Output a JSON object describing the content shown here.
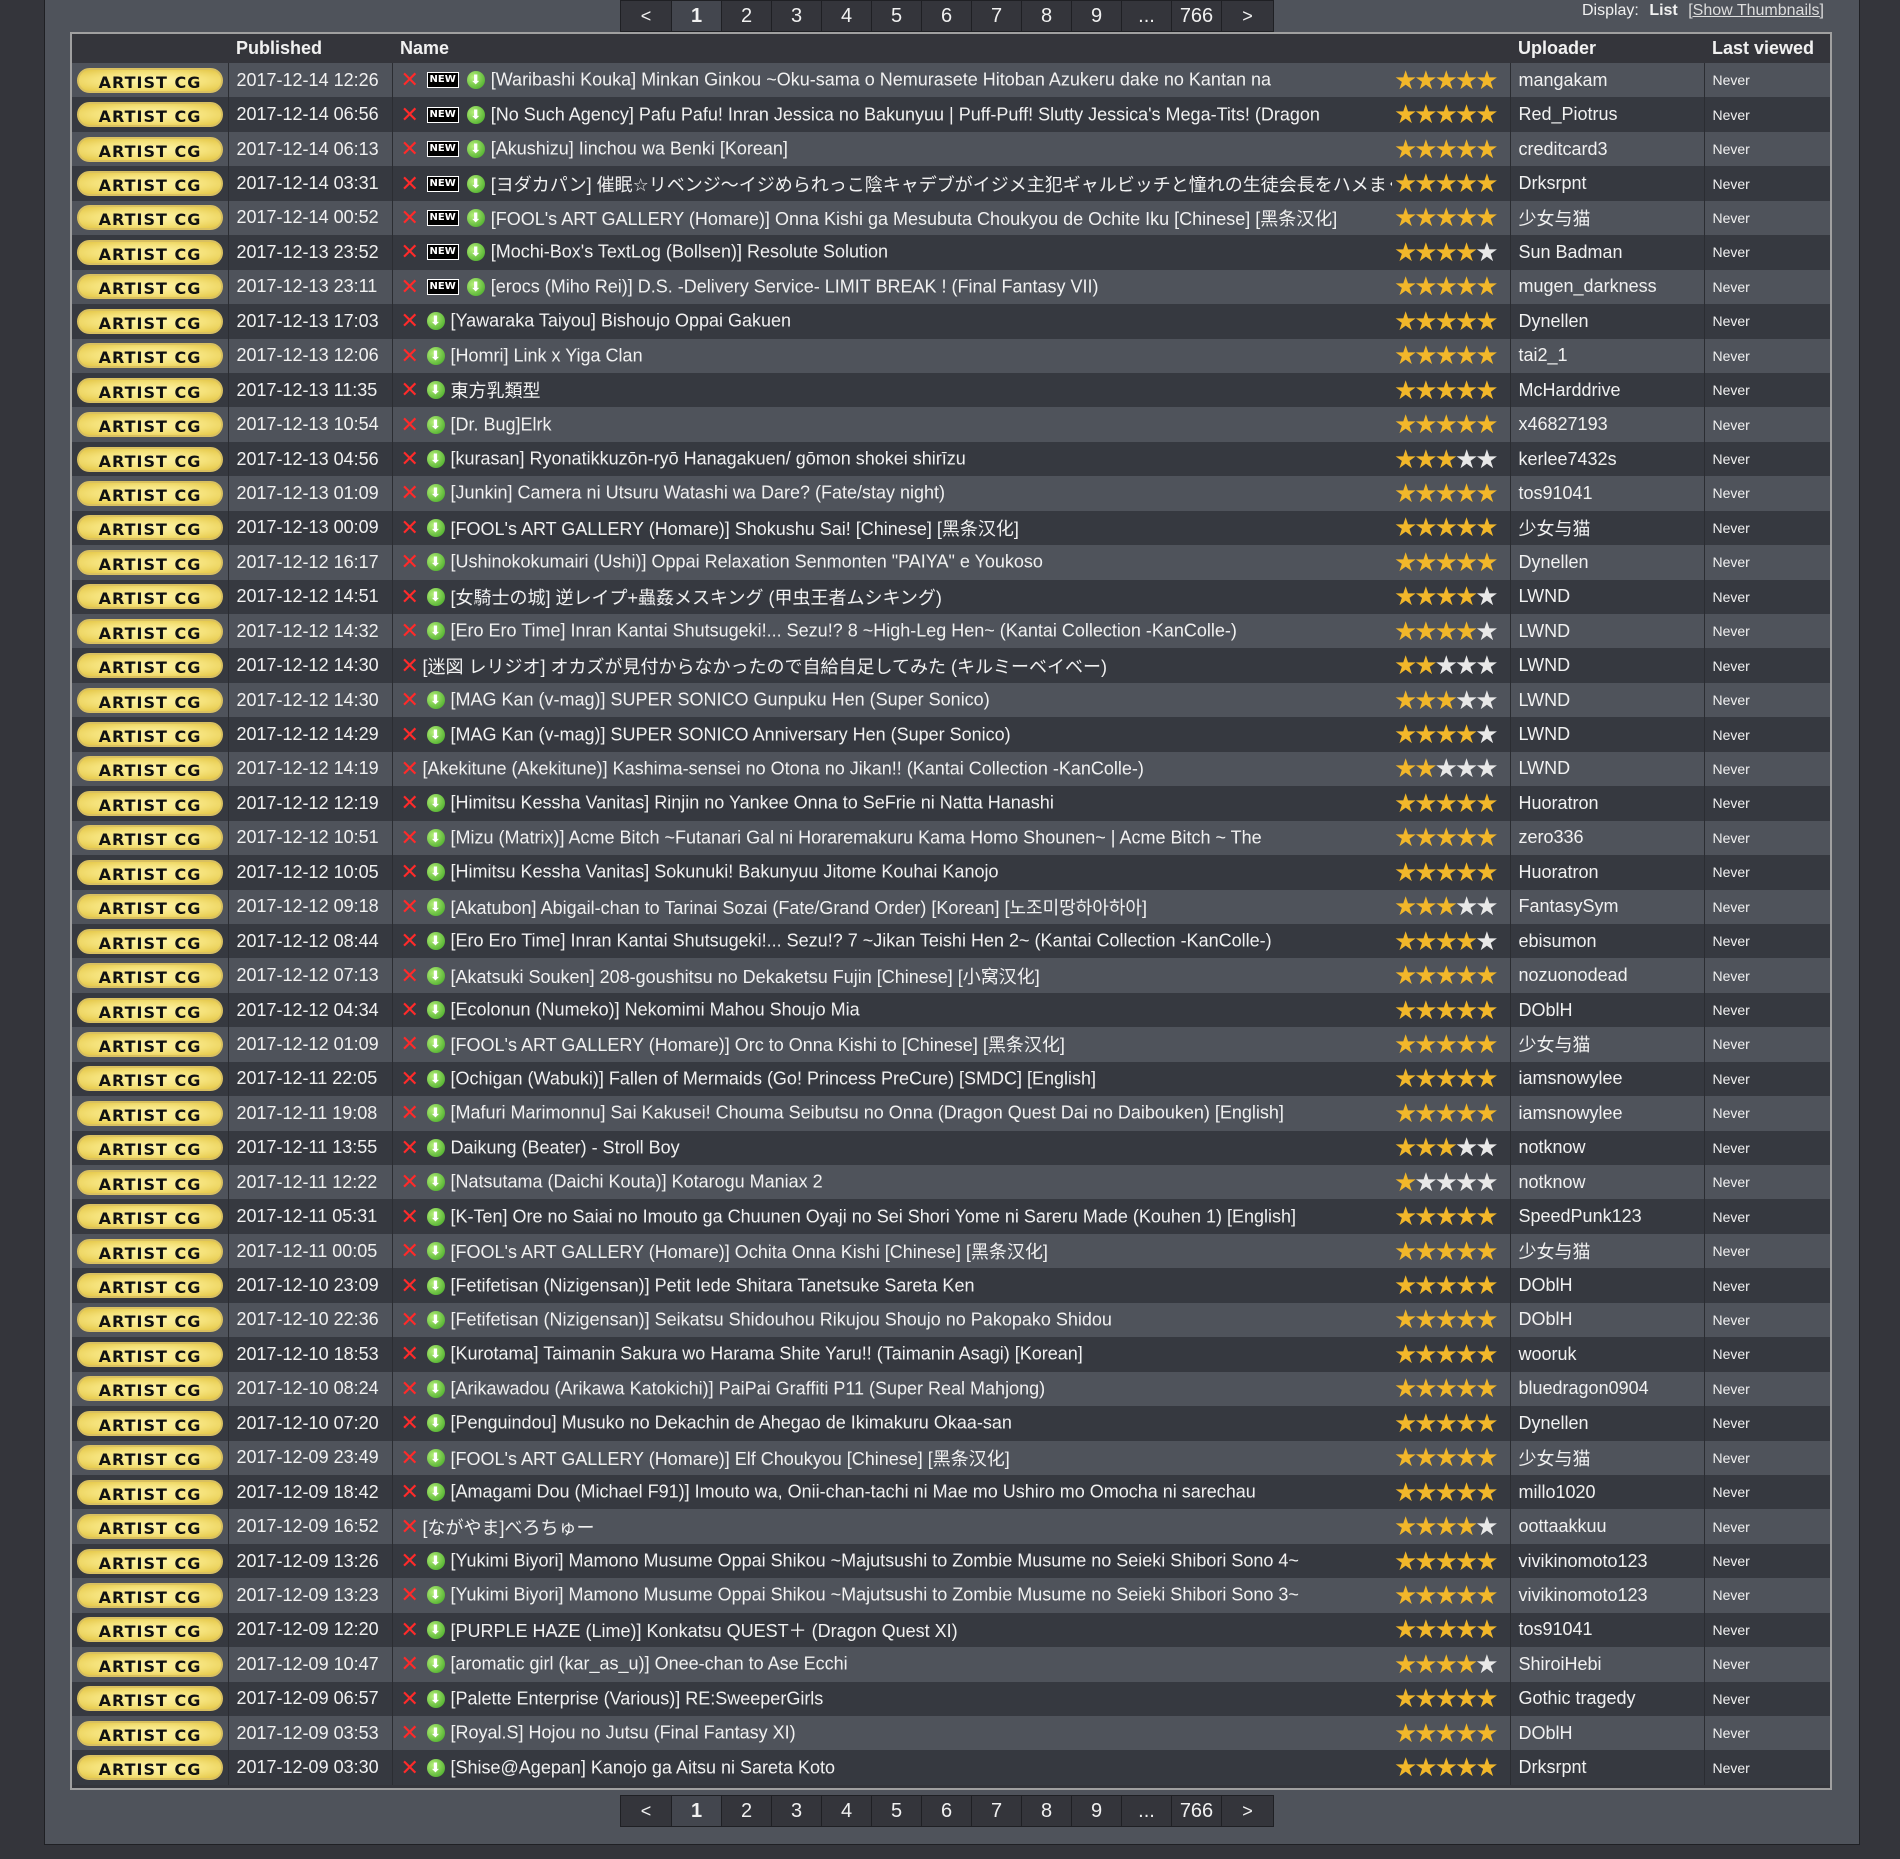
{
  "pager": {
    "pages": [
      "<",
      "1",
      "2",
      "3",
      "4",
      "5",
      "6",
      "7",
      "8",
      "9",
      "...",
      "766",
      ">"
    ],
    "current": "1"
  },
  "display": {
    "label": "Display:",
    "current": "List",
    "alternative": "[Show Thumbnails]"
  },
  "columns": [
    "Published",
    "Name",
    "Uploader",
    "Last viewed"
  ],
  "category_label": "ARTIST CG",
  "new_label": "NEW",
  "rows": [
    {
      "published": "2017-12-14 12:26",
      "new": true,
      "title": "[Waribashi Kouka] Minkan Ginkou ~Oku-sama o Nemurasete Hitoban Azukeru dake no Kantan na",
      "stars": 5,
      "uploader": "mangakam",
      "last": "Never"
    },
    {
      "published": "2017-12-14 06:56",
      "new": true,
      "title": "[No Such Agency] Pafu Pafu! Inran Jessica no Bakunyuu | Puff-Puff! Slutty Jessica's Mega-Tits! (Dragon",
      "stars": 5,
      "uploader": "Red_Piotrus",
      "last": "Never"
    },
    {
      "published": "2017-12-14 06:13",
      "new": true,
      "title": "[Akushizu] Iinchou wa Benki [Korean]",
      "stars": 5,
      "uploader": "creditcard3",
      "last": "Never"
    },
    {
      "published": "2017-12-14 03:31",
      "new": true,
      "title": "[ヨダカパン] 催眠☆リベンジ～イジめられっこ陰キャデブがイジメ主犯ギャルビッチと憧れの生徒会長をハメまく",
      "stars": 5,
      "uploader": "Drksrpnt",
      "last": "Never"
    },
    {
      "published": "2017-12-14 00:52",
      "new": true,
      "title": "[FOOL's ART GALLERY (Homare)] Onna Kishi ga Mesubuta Choukyou de Ochite Iku [Chinese] [黑条汉化]",
      "stars": 5,
      "uploader": "少女与猫",
      "last": "Never"
    },
    {
      "published": "2017-12-13 23:52",
      "new": true,
      "title": "[Mochi-Box's TextLog (Bollsen)] Resolute Solution",
      "stars": 4,
      "uploader": "Sun Badman",
      "last": "Never"
    },
    {
      "published": "2017-12-13 23:11",
      "new": true,
      "title": "[erocs (Miho Rei)] D.S. -Delivery Service- LIMIT BREAK ! (Final Fantasy VII)",
      "stars": 5,
      "uploader": "mugen_darkness",
      "last": "Never"
    },
    {
      "published": "2017-12-13 17:03",
      "new": false,
      "title": "[Yawaraka Taiyou] Bishoujo Oppai Gakuen",
      "stars": 5,
      "uploader": "Dynellen",
      "last": "Never"
    },
    {
      "published": "2017-12-13 12:06",
      "new": false,
      "title": "[Homri] Link x Yiga Clan",
      "stars": 5,
      "uploader": "tai2_1",
      "last": "Never"
    },
    {
      "published": "2017-12-13 11:35",
      "new": false,
      "title": "東方乳類型",
      "stars": 5,
      "uploader": "McHarddrive",
      "last": "Never"
    },
    {
      "published": "2017-12-13 10:54",
      "new": false,
      "title": "[Dr. Bug]Elrk",
      "stars": 5,
      "uploader": "x46827193",
      "last": "Never"
    },
    {
      "published": "2017-12-13 04:56",
      "new": false,
      "title": "[kurasan] Ryonatikkuzōn-ryō Hanagakuen/ gōmon shokei shirīzu",
      "stars": 3,
      "uploader": "kerlee7432s",
      "last": "Never"
    },
    {
      "published": "2017-12-13 01:09",
      "new": false,
      "title": "[Junkin] Camera ni Utsuru Watashi wa Dare? (Fate/stay night)",
      "stars": 5,
      "uploader": "tos91041",
      "last": "Never"
    },
    {
      "published": "2017-12-13 00:09",
      "new": false,
      "title": "[FOOL's ART GALLERY (Homare)] Shokushu Sai! [Chinese] [黑条汉化]",
      "stars": 5,
      "uploader": "少女与猫",
      "last": "Never"
    },
    {
      "published": "2017-12-12 16:17",
      "new": false,
      "title": "[Ushinokokumairi (Ushi)] Oppai Relaxation Senmonten \"PAIYA\" e Youkoso",
      "stars": 5,
      "uploader": "Dynellen",
      "last": "Never"
    },
    {
      "published": "2017-12-12 14:51",
      "new": false,
      "title": "[女騎士の城] 逆レイプ+蟲姦メスキング (甲虫王者ムシキング)",
      "stars": 4,
      "uploader": "LWND",
      "last": "Never"
    },
    {
      "published": "2017-12-12 14:32",
      "new": false,
      "title": "[Ero Ero Time] Inran Kantai Shutsugeki!... Sezu!? 8 ~High-Leg Hen~ (Kantai Collection -KanColle-)",
      "stars": 4,
      "uploader": "LWND",
      "last": "Never"
    },
    {
      "published": "2017-12-12 14:30",
      "new": false,
      "nodl": true,
      "title": "[迷図 レリジオ] オカズが見付からなかったので自給自足してみた (キルミーベイベー)",
      "stars": 2,
      "uploader": "LWND",
      "last": "Never"
    },
    {
      "published": "2017-12-12 14:30",
      "new": false,
      "title": "[MAG Kan (v-mag)] SUPER SONICO Gunpuku Hen (Super Sonico)",
      "stars": 3,
      "uploader": "LWND",
      "last": "Never"
    },
    {
      "published": "2017-12-12 14:29",
      "new": false,
      "title": "[MAG Kan (v-mag)] SUPER SONICO Anniversary Hen (Super Sonico)",
      "stars": 4,
      "uploader": "LWND",
      "last": "Never"
    },
    {
      "published": "2017-12-12 14:19",
      "new": false,
      "nodl": true,
      "title": "[Akekitune (Akekitune)] Kashima-sensei no Otona no Jikan!! (Kantai Collection -KanColle-)",
      "stars": 2,
      "uploader": "LWND",
      "last": "Never"
    },
    {
      "published": "2017-12-12 12:19",
      "new": false,
      "title": "[Himitsu Kessha Vanitas] Rinjin no Yankee Onna to SeFrie ni Natta Hanashi",
      "stars": 5,
      "uploader": "Huoratron",
      "last": "Never"
    },
    {
      "published": "2017-12-12 10:51",
      "new": false,
      "title": "[Mizu (Matrix)] Acme Bitch ~Futanari Gal ni Horaremakuru Kama Homo Shounen~ | Acme Bitch ~ The",
      "stars": 5,
      "uploader": "zero336",
      "last": "Never"
    },
    {
      "published": "2017-12-12 10:05",
      "new": false,
      "title": "[Himitsu Kessha Vanitas] Sokunuki! Bakunyuu Jitome Kouhai Kanojo",
      "stars": 5,
      "uploader": "Huoratron",
      "last": "Never"
    },
    {
      "published": "2017-12-12 09:18",
      "new": false,
      "title": "[Akatubon] Abigail-chan to Tarinai Sozai (Fate/Grand Order) [Korean] [노조미땅하아하아]",
      "stars": 3,
      "uploader": "FantasySym",
      "last": "Never"
    },
    {
      "published": "2017-12-12 08:44",
      "new": false,
      "title": "[Ero Ero Time] Inran Kantai Shutsugeki!... Sezu!? 7 ~Jikan Teishi Hen 2~ (Kantai Collection -KanColle-)",
      "stars": 4,
      "uploader": "ebisumon",
      "last": "Never"
    },
    {
      "published": "2017-12-12 07:13",
      "new": false,
      "title": "[Akatsuki Souken] 208-goushitsu no Dekaketsu Fujin [Chinese] [小窝汉化]",
      "stars": 5,
      "uploader": "nozuonodead",
      "last": "Never"
    },
    {
      "published": "2017-12-12 04:34",
      "new": false,
      "title": "[Ecolonun (Numeko)] Nekomimi Mahou Shoujo Mia",
      "stars": 5,
      "uploader": "DOblH",
      "last": "Never"
    },
    {
      "published": "2017-12-12 01:09",
      "new": false,
      "title": "[FOOL's ART GALLERY (Homare)] Orc to Onna Kishi to [Chinese] [黑条汉化]",
      "stars": 5,
      "uploader": "少女与猫",
      "last": "Never"
    },
    {
      "published": "2017-12-11 22:05",
      "new": false,
      "title": "[Ochigan (Wabuki)] Fallen of Mermaids (Go! Princess PreCure) [SMDC] [English]",
      "stars": 5,
      "uploader": "iamsnowylee",
      "last": "Never"
    },
    {
      "published": "2017-12-11 19:08",
      "new": false,
      "title": "[Mafuri Marimonnu] Sai Kakusei! Chouma Seibutsu no Onna (Dragon Quest Dai no Daibouken) [English]",
      "stars": 5,
      "uploader": "iamsnowylee",
      "last": "Never"
    },
    {
      "published": "2017-12-11 13:55",
      "new": false,
      "title": "Daikung (Beater) - Stroll Boy",
      "stars": 3,
      "uploader": "notknow",
      "last": "Never"
    },
    {
      "published": "2017-12-11 12:22",
      "new": false,
      "title": "[Natsutama (Daichi Kouta)] Kotarogu Maniax 2",
      "stars": 1,
      "uploader": "notknow",
      "last": "Never"
    },
    {
      "published": "2017-12-11 05:31",
      "new": false,
      "title": "[K-Ten] Ore no Saiai no Imouto ga Chuunen Oyaji no Sei Shori Yome ni Sareru Made (Kouhen 1) [English]",
      "stars": 5,
      "uploader": "SpeedPunk123",
      "last": "Never"
    },
    {
      "published": "2017-12-11 00:05",
      "new": false,
      "title": "[FOOL's ART GALLERY (Homare)] Ochita Onna Kishi [Chinese] [黑条汉化]",
      "stars": 5,
      "uploader": "少女与猫",
      "last": "Never"
    },
    {
      "published": "2017-12-10 23:09",
      "new": false,
      "title": "[Fetifetisan (Nizigensan)] Petit Iede Shitara Tanetsuke Sareta Ken",
      "stars": 5,
      "uploader": "DOblH",
      "last": "Never"
    },
    {
      "published": "2017-12-10 22:36",
      "new": false,
      "title": "[Fetifetisan (Nizigensan)] Seikatsu Shidouhou Rikujou Shoujo no Pakopako Shidou",
      "stars": 5,
      "uploader": "DOblH",
      "last": "Never"
    },
    {
      "published": "2017-12-10 18:53",
      "new": false,
      "title": "[Kurotama] Taimanin Sakura wo Harama Shite Yaru!! (Taimanin Asagi) [Korean]",
      "stars": 5,
      "uploader": "wooruk",
      "last": "Never"
    },
    {
      "published": "2017-12-10 08:24",
      "new": false,
      "title": "[Arikawadou (Arikawa Katokichi)] PaiPai Graffiti P11 (Super Real Mahjong)",
      "stars": 5,
      "uploader": "bluedragon0904",
      "last": "Never"
    },
    {
      "published": "2017-12-10 07:20",
      "new": false,
      "title": "[Penguindou] Musuko no Dekachin de Ahegao de Ikimakuru Okaa-san",
      "stars": 5,
      "uploader": "Dynellen",
      "last": "Never"
    },
    {
      "published": "2017-12-09 23:49",
      "new": false,
      "title": "[FOOL's ART GALLERY (Homare)] Elf Choukyou [Chinese] [黑条汉化]",
      "stars": 5,
      "uploader": "少女与猫",
      "last": "Never"
    },
    {
      "published": "2017-12-09 18:42",
      "new": false,
      "title": "[Amagami Dou (Michael F91)] Imouto wa, Onii-chan-tachi ni Mae mo Ushiro mo Omocha ni sarechau",
      "stars": 5,
      "uploader": "millo1020",
      "last": "Never"
    },
    {
      "published": "2017-12-09 16:52",
      "new": false,
      "nodl": true,
      "title": "[ながやま]べろちゅー",
      "stars": 4,
      "uploader": "oottaakkuu",
      "last": "Never"
    },
    {
      "published": "2017-12-09 13:26",
      "new": false,
      "title": "[Yukimi Biyori] Mamono Musume Oppai Shikou ~Majutsushi to Zombie Musume no Seieki Shibori Sono 4~",
      "stars": 5,
      "uploader": "vivikinomoto123",
      "last": "Never"
    },
    {
      "published": "2017-12-09 13:23",
      "new": false,
      "title": "[Yukimi Biyori] Mamono Musume Oppai Shikou ~Majutsushi to Zombie Musume no Seieki Shibori Sono 3~",
      "stars": 5,
      "uploader": "vivikinomoto123",
      "last": "Never"
    },
    {
      "published": "2017-12-09 12:20",
      "new": false,
      "title": "[PURPLE HAZE (Lime)] Konkatsu QUEST＋ (Dragon Quest XI)",
      "stars": 5,
      "uploader": "tos91041",
      "last": "Never"
    },
    {
      "published": "2017-12-09 10:47",
      "new": false,
      "title": "[aromatic girl (kar_as_u)] Onee-chan to Ase Ecchi",
      "stars": 4,
      "uploader": "ShiroiHebi",
      "last": "Never"
    },
    {
      "published": "2017-12-09 06:57",
      "new": false,
      "title": "[Palette Enterprise (Various)] RE:SweeperGirls",
      "stars": 5,
      "uploader": "Gothic tragedy",
      "last": "Never"
    },
    {
      "published": "2017-12-09 03:53",
      "new": false,
      "title": "[Royal.S] Hojou no Jutsu (Final Fantasy XI)",
      "stars": 5,
      "uploader": "DOblH",
      "last": "Never"
    },
    {
      "published": "2017-12-09 03:30",
      "new": false,
      "title": "[Shise@Agepan] Kanojo ga Aitsu ni Sareta Koto",
      "stars": 5,
      "uploader": "Drksrpnt",
      "last": "Never"
    }
  ]
}
